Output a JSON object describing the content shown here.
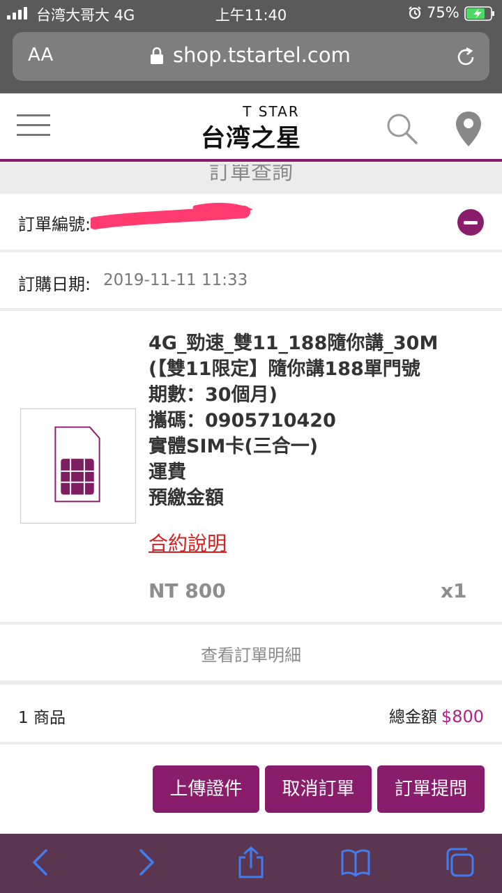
{
  "status_bar": {
    "carrier": "台湾大哥大 4G",
    "time": "上午11:40",
    "battery": "75%"
  },
  "browser": {
    "text_size_label": "AA",
    "url": "shop.tstartel.com"
  },
  "site_header": {
    "logo_en": "T STAR",
    "logo_zh": "台湾之星"
  },
  "page_title": "訂單查詢",
  "order": {
    "number_label": "訂單編號:",
    "date_label": "訂購日期:",
    "date_value": "2019-11-11 11:33"
  },
  "product": {
    "lines": [
      "4G_勁速_雙11_188隨你講_30M",
      "(【雙11限定】隨你講188單門號",
      "期數：30個月)",
      "攜碼：0905710420",
      "實體SIM卡(三合一)",
      "運費",
      "預繳金額"
    ],
    "contract_link": "合約說明",
    "price": "NT 800",
    "quantity": "x1"
  },
  "view_detail_label": "查看訂單明細",
  "summary": {
    "items": "1 商品",
    "total_label": "總金額",
    "total_amount": "$800"
  },
  "actions": {
    "upload": "上傳證件",
    "cancel": "取消訂單",
    "ask": "訂單提問"
  },
  "colors": {
    "brand": "#8a1d6b",
    "price_accent": "#b01e8e",
    "link_red": "#d6201f",
    "toolbar_icon": "#3f7df0"
  }
}
